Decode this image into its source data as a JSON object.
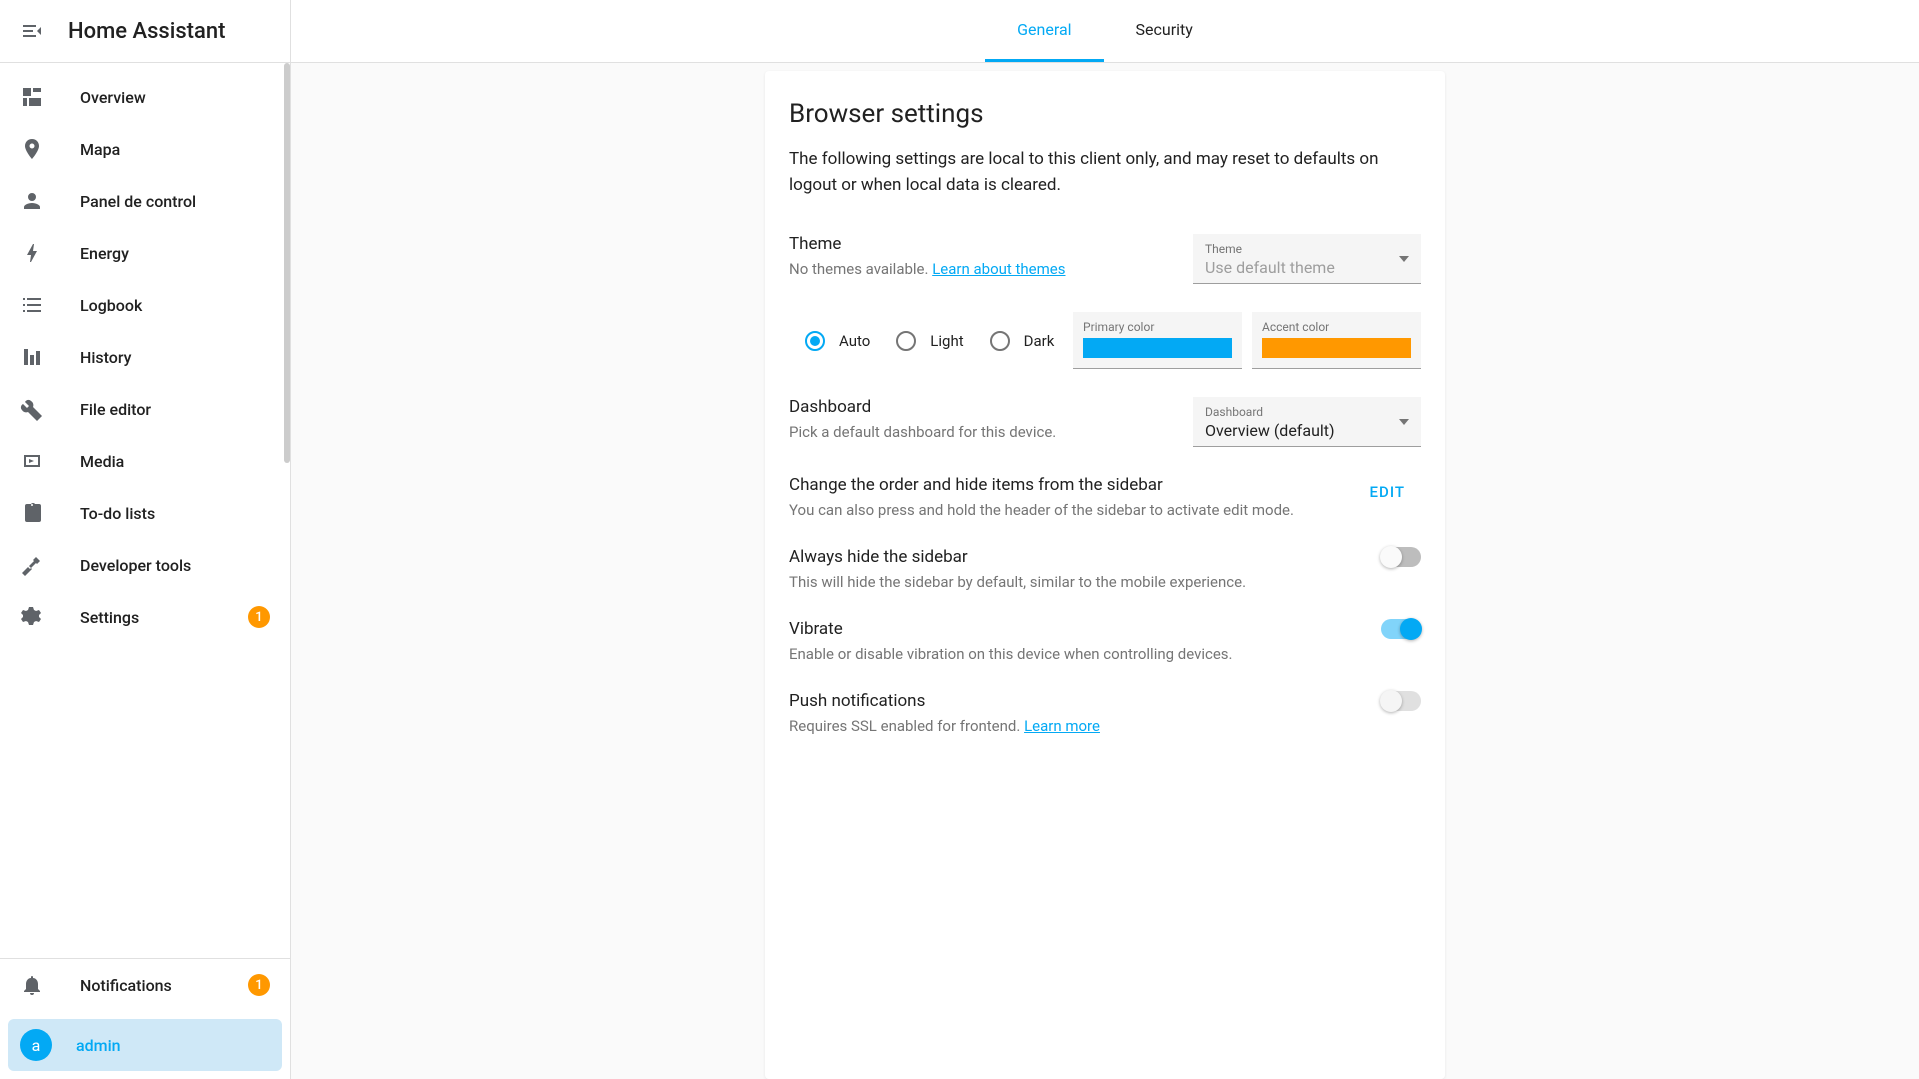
{
  "app": {
    "title": "Home Assistant"
  },
  "sidebar": {
    "items": [
      {
        "label": "Overview"
      },
      {
        "label": "Mapa"
      },
      {
        "label": "Panel de control"
      },
      {
        "label": "Energy"
      },
      {
        "label": "Logbook"
      },
      {
        "label": "History"
      },
      {
        "label": "File editor"
      },
      {
        "label": "Media"
      },
      {
        "label": "To-do lists"
      },
      {
        "label": "Developer tools"
      },
      {
        "label": "Settings",
        "badge": "1"
      }
    ],
    "notifications": {
      "label": "Notifications",
      "badge": "1"
    },
    "user": {
      "initial": "a",
      "name": "admin"
    }
  },
  "tabs": {
    "general": "General",
    "security": "Security"
  },
  "settings": {
    "title": "Browser settings",
    "description": "The following settings are local to this client only, and may reset to defaults on logout or when local data is cleared.",
    "theme": {
      "title": "Theme",
      "subtitle": "No themes available. ",
      "link": "Learn about themes",
      "select_label": "Theme",
      "select_value": "Use default theme",
      "modes": {
        "auto": "Auto",
        "light": "Light",
        "dark": "Dark"
      },
      "primary_label": "Primary color",
      "primary_color": "#03a9f4",
      "accent_label": "Accent color",
      "accent_color": "#ff9800"
    },
    "dashboard": {
      "title": "Dashboard",
      "subtitle": "Pick a default dashboard for this device.",
      "select_label": "Dashboard",
      "select_value": "Overview (default)"
    },
    "sidebar_order": {
      "title": "Change the order and hide items from the sidebar",
      "subtitle": "You can also press and hold the header of the sidebar to activate edit mode.",
      "edit": "EDIT"
    },
    "hide_sidebar": {
      "title": "Always hide the sidebar",
      "subtitle": "This will hide the sidebar by default, similar to the mobile experience."
    },
    "vibrate": {
      "title": "Vibrate",
      "subtitle": "Enable or disable vibration on this device when controlling devices."
    },
    "push": {
      "title": "Push notifications",
      "subtitle": "Requires SSL enabled for frontend. ",
      "link": "Learn more"
    }
  }
}
